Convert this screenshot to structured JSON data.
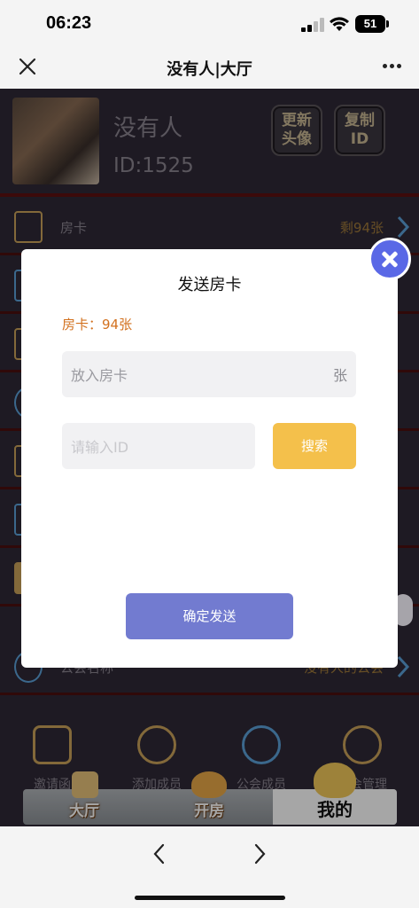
{
  "status": {
    "time": "06:23",
    "battery": "51"
  },
  "nav": {
    "title": "没有人|大厅"
  },
  "profile": {
    "name": "没有人",
    "id": "ID:1525",
    "update_avatar": "更新\n头像",
    "copy_id": "复制\nID"
  },
  "rows": [
    {
      "label": "房卡",
      "value": "剩94张"
    },
    {
      "label": "公会名称",
      "value": "没有人的公会"
    }
  ],
  "grid": [
    {
      "label": "邀请函"
    },
    {
      "label": "添加成员"
    },
    {
      "label": "公会成员"
    },
    {
      "label": "公会管理"
    }
  ],
  "tabs": [
    {
      "label": "大厅"
    },
    {
      "label": "开房"
    },
    {
      "label": "我的"
    }
  ],
  "modal": {
    "title": "发送房卡",
    "count": "房卡：94张",
    "card_placeholder": "放入房卡",
    "card_unit": "张",
    "id_placeholder": "请输入ID",
    "search": "搜索",
    "confirm": "确定发送"
  },
  "colors": {
    "accent_blue": "#5a68e6",
    "confirm": "#727bd0",
    "search": "#f4c04b",
    "count_text": "#d2711f"
  }
}
